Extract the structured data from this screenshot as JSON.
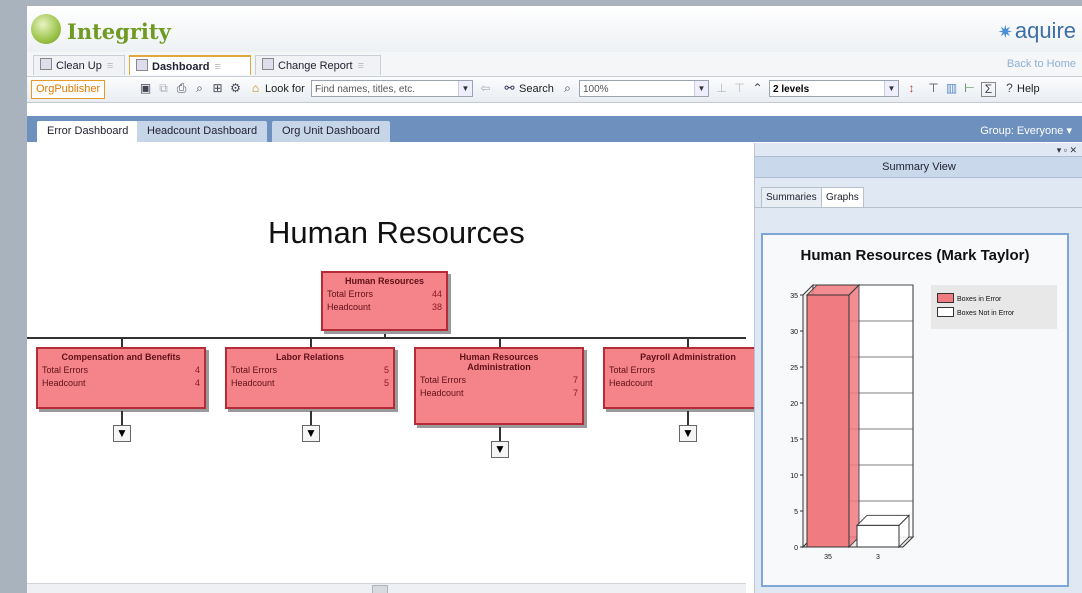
{
  "app": {
    "title": "Integrity",
    "brand": "aquire"
  },
  "page_tabs": [
    {
      "label": "Clean Up",
      "close": "≡",
      "active": false
    },
    {
      "label": "Dashboard",
      "close": "≡",
      "active": true
    },
    {
      "label": "Change Report",
      "close": "≡",
      "active": false
    }
  ],
  "back_link": "Back to Home",
  "toolbar": {
    "orgpublisher": "OrgPublisher",
    "look_for_label": "Look for",
    "look_for_placeholder": "Find names, titles, etc.",
    "search_label": "Search",
    "zoom_value": "100%",
    "levels_value": "2 levels",
    "help_label": "Help"
  },
  "dashboard_tabs": [
    {
      "label": "Error Dashboard",
      "active": true
    },
    {
      "label": "Headcount Dashboard",
      "active": false
    },
    {
      "label": "Org Unit Dashboard",
      "active": false
    }
  ],
  "group_label": "Group: Everyone",
  "org_chart": {
    "title": "Human Resources",
    "root": {
      "name": "Human Resources",
      "rows": [
        {
          "label": "Total Errors",
          "value": "44"
        },
        {
          "label": "Headcount",
          "value": "38"
        }
      ]
    },
    "children": [
      {
        "name": "Compensation and Benefits",
        "rows": [
          {
            "label": "Total Errors",
            "value": "4"
          },
          {
            "label": "Headcount",
            "value": "4"
          }
        ]
      },
      {
        "name": "Labor Relations",
        "rows": [
          {
            "label": "Total Errors",
            "value": "5"
          },
          {
            "label": "Headcount",
            "value": "5"
          }
        ]
      },
      {
        "name": "Human Resources Administration",
        "rows": [
          {
            "label": "Total Errors",
            "value": "7"
          },
          {
            "label": "Headcount",
            "value": "7"
          }
        ]
      },
      {
        "name": "Payroll Administration",
        "rows": [
          {
            "label": "Total Errors",
            "value": ""
          },
          {
            "label": "Headcount",
            "value": ""
          }
        ]
      }
    ],
    "expander_symbol": "▼"
  },
  "summary_panel": {
    "controls": "▾ ▫ ✕",
    "title": "Summary View",
    "tabs": [
      {
        "label": "Summaries",
        "active": false
      },
      {
        "label": "Graphs",
        "active": true
      }
    ],
    "graph_title": "Human Resources (Mark Taylor)"
  },
  "chart_data": {
    "type": "bar",
    "title": "Human Resources (Mark Taylor)",
    "categories": [
      "35",
      "3"
    ],
    "series": [
      {
        "name": "Boxes in Error",
        "values": [
          35,
          0
        ],
        "color": "#f07b80"
      },
      {
        "name": "Boxes Not in Error",
        "values": [
          0,
          3
        ],
        "color": "#ffffff"
      }
    ],
    "ylim": [
      0,
      35
    ],
    "yticks": [
      0,
      5,
      10,
      15,
      20,
      25,
      30,
      35
    ],
    "grid": true,
    "legend": "top-right",
    "style": "3d"
  },
  "colors": {
    "node_fill": "#f4838a",
    "node_border": "#b52b36",
    "tab_bar": "#6d90bf",
    "accent": "#e0a83c"
  }
}
